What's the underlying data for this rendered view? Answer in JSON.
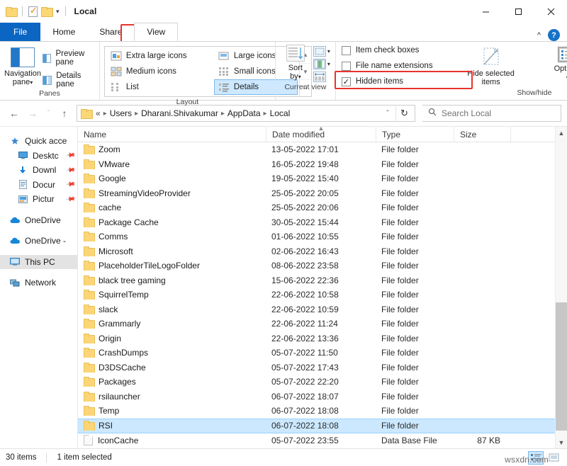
{
  "window": {
    "title": "Local",
    "quick_access": [
      "folder-icon",
      "properties-icon",
      "new-folder-icon",
      "customize-caret"
    ],
    "controls": {
      "minimize": "—",
      "maximize": "□",
      "close": "✕"
    },
    "ribbon_collapse": "^",
    "help": "?"
  },
  "tabs": [
    {
      "label": "File",
      "active": false,
      "kind": "file"
    },
    {
      "label": "Home",
      "active": false
    },
    {
      "label": "Share",
      "active": false
    },
    {
      "label": "View",
      "active": true,
      "highlighted": true
    }
  ],
  "ribbon": {
    "panes_group": {
      "label": "Panes",
      "navigation_pane": {
        "line1": "Navigation",
        "line2": "pane",
        "caret": "▾"
      },
      "commands": [
        {
          "label": "Preview pane"
        },
        {
          "label": "Details pane"
        }
      ]
    },
    "layout_group": {
      "label": "Layout",
      "items": [
        {
          "label": "Extra large icons",
          "selected": false
        },
        {
          "label": "Large icons",
          "selected": false
        },
        {
          "label": "Medium icons",
          "selected": false
        },
        {
          "label": "Small icons",
          "selected": false
        },
        {
          "label": "List",
          "selected": false
        },
        {
          "label": "Details",
          "selected": true
        }
      ],
      "scroll": [
        "▲",
        "▼",
        "≡"
      ]
    },
    "current_view_group": {
      "label": "Current view",
      "sort_by": {
        "line1": "Sort",
        "line2": "by",
        "caret": "▾"
      },
      "mini_commands": [
        "group-by",
        "add-columns",
        "size-all-columns-to-fit"
      ]
    },
    "show_hide_group": {
      "label": "Show/hide",
      "checkboxes": [
        {
          "label": "Item check boxes",
          "checked": false
        },
        {
          "label": "File name extensions",
          "checked": false
        },
        {
          "label": "Hidden items",
          "checked": true,
          "highlighted": true
        }
      ],
      "hide_selected": {
        "line1": "Hide selected",
        "line2": "items"
      },
      "options": {
        "label": "Options",
        "caret": "▾"
      }
    }
  },
  "address_bar": {
    "back": "←",
    "forward": "→",
    "recent": "ˇ",
    "up": "↑",
    "breadcrumbs": [
      "«",
      "Users",
      "Dharani.Shivakumar",
      "AppData",
      "Local"
    ],
    "dropdown": "ˇ",
    "refresh": "↻",
    "search_placeholder": "Search Local"
  },
  "sidebar": {
    "groups": [
      {
        "items": [
          {
            "label": "Quick acce",
            "icon": "star-icon",
            "indent": false,
            "pinned": false,
            "selected": false
          },
          {
            "label": "Desktc",
            "icon": "desktop-icon",
            "indent": true,
            "pinned": true,
            "selected": false
          },
          {
            "label": "Downl",
            "icon": "download-icon",
            "indent": true,
            "pinned": true,
            "selected": false
          },
          {
            "label": "Docur",
            "icon": "documents-icon",
            "indent": true,
            "pinned": true,
            "selected": false
          },
          {
            "label": "Pictur",
            "icon": "pictures-icon",
            "indent": true,
            "pinned": true,
            "selected": false
          }
        ]
      },
      {
        "items": [
          {
            "label": "OneDrive",
            "icon": "onedrive-icon",
            "indent": false,
            "pinned": false,
            "selected": false
          }
        ]
      },
      {
        "items": [
          {
            "label": "OneDrive -",
            "icon": "onedrive-icon",
            "indent": false,
            "pinned": false,
            "selected": false
          }
        ]
      },
      {
        "items": [
          {
            "label": "This PC",
            "icon": "thispc-icon",
            "indent": false,
            "pinned": false,
            "selected": true
          }
        ]
      },
      {
        "items": [
          {
            "label": "Network",
            "icon": "network-icon",
            "indent": false,
            "pinned": false,
            "selected": false
          }
        ]
      }
    ]
  },
  "file_list": {
    "columns": [
      {
        "key": "name",
        "label": "Name",
        "sorted": false
      },
      {
        "key": "date",
        "label": "Date modified",
        "sorted": true,
        "direction": "asc"
      },
      {
        "key": "type",
        "label": "Type",
        "sorted": false
      },
      {
        "key": "size",
        "label": "Size",
        "sorted": false
      }
    ],
    "rows": [
      {
        "name": "Zoom",
        "date": "13-05-2022 17:01",
        "type": "File folder",
        "size": "",
        "icon": "folder-icon",
        "selected": false
      },
      {
        "name": "VMware",
        "date": "16-05-2022 19:48",
        "type": "File folder",
        "size": "",
        "icon": "folder-icon",
        "selected": false
      },
      {
        "name": "Google",
        "date": "19-05-2022 15:40",
        "type": "File folder",
        "size": "",
        "icon": "folder-icon",
        "selected": false
      },
      {
        "name": "StreamingVideoProvider",
        "date": "25-05-2022 20:05",
        "type": "File folder",
        "size": "",
        "icon": "folder-icon",
        "selected": false
      },
      {
        "name": "cache",
        "date": "25-05-2022 20:06",
        "type": "File folder",
        "size": "",
        "icon": "folder-icon",
        "selected": false
      },
      {
        "name": "Package Cache",
        "date": "30-05-2022 15:44",
        "type": "File folder",
        "size": "",
        "icon": "folder-icon",
        "selected": false
      },
      {
        "name": "Comms",
        "date": "01-06-2022 10:55",
        "type": "File folder",
        "size": "",
        "icon": "folder-icon",
        "selected": false
      },
      {
        "name": "Microsoft",
        "date": "02-06-2022 16:43",
        "type": "File folder",
        "size": "",
        "icon": "folder-icon",
        "selected": false
      },
      {
        "name": "PlaceholderTileLogoFolder",
        "date": "08-06-2022 23:58",
        "type": "File folder",
        "size": "",
        "icon": "folder-icon",
        "selected": false
      },
      {
        "name": "black tree gaming",
        "date": "15-06-2022 22:36",
        "type": "File folder",
        "size": "",
        "icon": "folder-icon",
        "selected": false
      },
      {
        "name": "SquirrelTemp",
        "date": "22-06-2022 10:58",
        "type": "File folder",
        "size": "",
        "icon": "folder-icon",
        "selected": false
      },
      {
        "name": "slack",
        "date": "22-06-2022 10:59",
        "type": "File folder",
        "size": "",
        "icon": "folder-icon",
        "selected": false
      },
      {
        "name": "Grammarly",
        "date": "22-06-2022 11:24",
        "type": "File folder",
        "size": "",
        "icon": "folder-icon",
        "selected": false
      },
      {
        "name": "Origin",
        "date": "22-06-2022 13:36",
        "type": "File folder",
        "size": "",
        "icon": "folder-icon",
        "selected": false
      },
      {
        "name": "CrashDumps",
        "date": "05-07-2022 11:50",
        "type": "File folder",
        "size": "",
        "icon": "folder-icon",
        "selected": false
      },
      {
        "name": "D3DSCache",
        "date": "05-07-2022 17:43",
        "type": "File folder",
        "size": "",
        "icon": "folder-icon",
        "selected": false
      },
      {
        "name": "Packages",
        "date": "05-07-2022 22:20",
        "type": "File folder",
        "size": "",
        "icon": "folder-icon",
        "selected": false
      },
      {
        "name": "rsilauncher",
        "date": "06-07-2022 18:07",
        "type": "File folder",
        "size": "",
        "icon": "folder-icon",
        "selected": false
      },
      {
        "name": "Temp",
        "date": "06-07-2022 18:08",
        "type": "File folder",
        "size": "",
        "icon": "folder-icon",
        "selected": false
      },
      {
        "name": "RSI",
        "date": "06-07-2022 18:08",
        "type": "File folder",
        "size": "",
        "icon": "folder-icon",
        "selected": true
      },
      {
        "name": "IconCache",
        "date": "05-07-2022 23:55",
        "type": "Data Base File",
        "size": "87 KB",
        "icon": "file-icon",
        "selected": false
      }
    ]
  },
  "status_bar": {
    "item_count": "30 items",
    "selection": "1 item selected",
    "view_buttons": [
      {
        "name": "details-view",
        "active": true
      },
      {
        "name": "large-icons-view",
        "active": false
      }
    ],
    "watermark": "wsxdn.com"
  },
  "colors": {
    "accent": "#0b65c2",
    "highlight_red": "#e8342b",
    "selection_blue": "#cce8ff",
    "folder_yellow": "#fcd676"
  }
}
